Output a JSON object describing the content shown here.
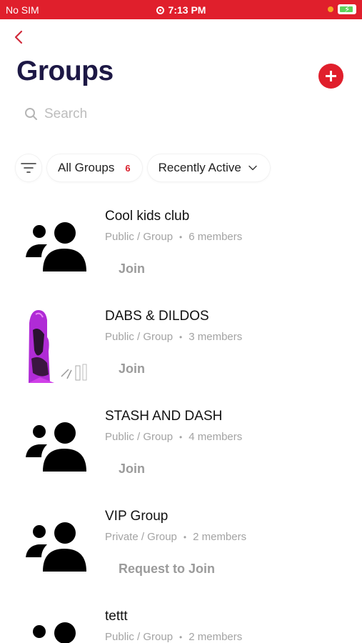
{
  "status_bar": {
    "carrier": "No SIM",
    "time": "7:13 PM"
  },
  "header": {
    "title": "Groups"
  },
  "search": {
    "placeholder": "Search"
  },
  "filters": {
    "all_groups_label": "All Groups",
    "all_groups_count": "6",
    "sort_label": "Recently Active"
  },
  "groups": [
    {
      "name": "Cool kids club",
      "type": "Public / Group",
      "separator": "•",
      "members": "6 members",
      "action": "Join",
      "avatar": "people-icon"
    },
    {
      "name": "DABS & DILDOS",
      "type": "Public / Group",
      "separator": "•",
      "members": "3 members",
      "action": "Join",
      "avatar": "group-photo"
    },
    {
      "name": "STASH AND DASH",
      "type": "Public / Group",
      "separator": "•",
      "members": "4 members",
      "action": "Join",
      "avatar": "people-icon"
    },
    {
      "name": "VIP Group",
      "type": "Private / Group",
      "separator": "•",
      "members": "2 members",
      "action": "Request to Join",
      "avatar": "people-icon"
    },
    {
      "name": "tettt",
      "type": "Public / Group",
      "separator": "•",
      "members": "2 members",
      "action": "",
      "avatar": "people-icon"
    }
  ],
  "colors": {
    "accent": "#e01f2c",
    "title": "#1d1845",
    "muted": "#a3a3a3"
  }
}
